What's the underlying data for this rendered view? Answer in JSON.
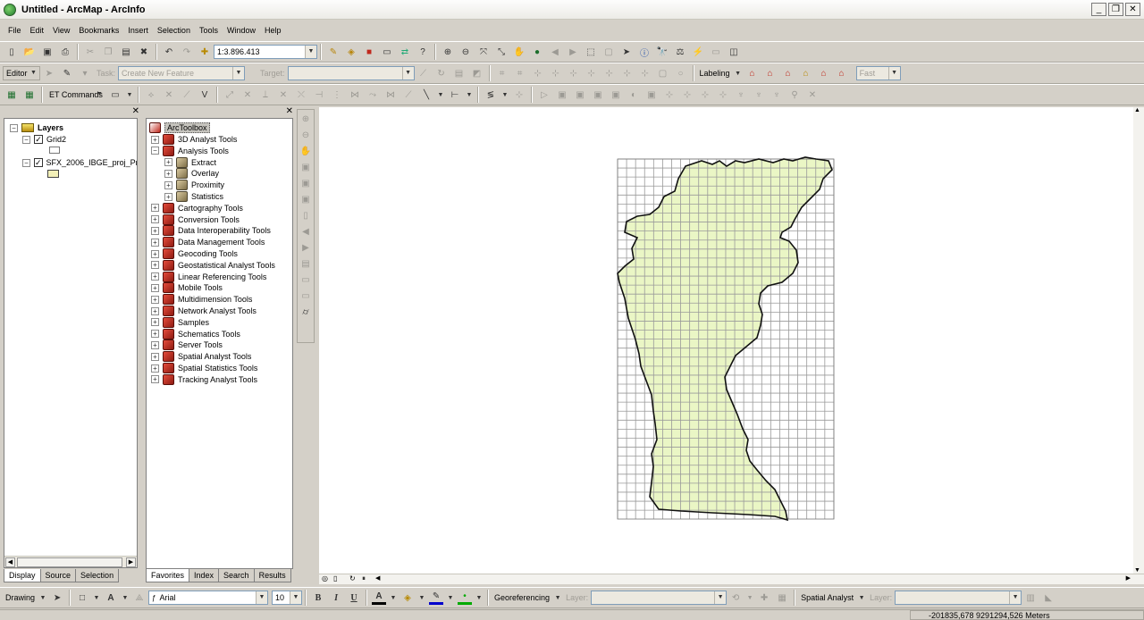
{
  "window": {
    "title": "Untitled - ArcMap - ArcInfo",
    "btns": [
      "_",
      "❐",
      "✕"
    ]
  },
  "menu": [
    "File",
    "Edit",
    "View",
    "Bookmarks",
    "Insert",
    "Selection",
    "Tools",
    "Window",
    "Help"
  ],
  "toolbar_standard": {
    "scale": "1:3.896.413"
  },
  "toolbar_editor": {
    "editor": "Editor",
    "task_label": "Task:",
    "task_value": "Create New Feature",
    "target_label": "Target:",
    "labeling": "Labeling",
    "fast": "Fast"
  },
  "toolbar_et": {
    "et": "ET Commands"
  },
  "toc": {
    "root": "Layers",
    "layers": [
      {
        "name": "Grid2",
        "checked": true
      },
      {
        "name": "SFX_2006_IBGE_proj_Pr",
        "checked": true
      }
    ],
    "tabs": [
      "Display",
      "Source",
      "Selection"
    ]
  },
  "toolbox": {
    "root": "ArcToolbox",
    "items": [
      {
        "label": "3D Analyst Tools",
        "expanded": false,
        "level": 0
      },
      {
        "label": "Analysis Tools",
        "expanded": true,
        "level": 0
      },
      {
        "label": "Extract",
        "level": 1
      },
      {
        "label": "Overlay",
        "level": 1
      },
      {
        "label": "Proximity",
        "level": 1
      },
      {
        "label": "Statistics",
        "level": 1
      },
      {
        "label": "Cartography Tools",
        "level": 0
      },
      {
        "label": "Conversion Tools",
        "level": 0
      },
      {
        "label": "Data Interoperability Tools",
        "level": 0
      },
      {
        "label": "Data Management Tools",
        "level": 0
      },
      {
        "label": "Geocoding Tools",
        "level": 0
      },
      {
        "label": "Geostatistical Analyst Tools",
        "level": 0
      },
      {
        "label": "Linear Referencing Tools",
        "level": 0
      },
      {
        "label": "Mobile Tools",
        "level": 0
      },
      {
        "label": "Multidimension Tools",
        "level": 0
      },
      {
        "label": "Network Analyst Tools",
        "level": 0
      },
      {
        "label": "Samples",
        "level": 0
      },
      {
        "label": "Schematics Tools",
        "level": 0
      },
      {
        "label": "Server Tools",
        "level": 0
      },
      {
        "label": "Spatial Analyst Tools",
        "level": 0
      },
      {
        "label": "Spatial Statistics Tools",
        "level": 0
      },
      {
        "label": "Tracking Analyst Tools",
        "level": 0
      }
    ],
    "tabs": [
      "Favorites",
      "Index",
      "Search",
      "Results"
    ]
  },
  "drawing": {
    "drawing": "Drawing",
    "font": "Arial",
    "size": "10",
    "bold": "B",
    "italic": "I",
    "underline": "U",
    "georef": "Georeferencing",
    "layer_label": "Layer:",
    "spatial": "Spatial Analyst",
    "layer2_label": "Layer:"
  },
  "status": {
    "coords": "-201835,678  9291294,526 Meters"
  },
  "colors": {
    "polygon_fill": "#eaf6c5",
    "grid_line": "#9a9a9a",
    "toolbox_red": "#c0281c"
  },
  "icons": [
    "new-icon",
    "open-icon",
    "save-icon",
    "print-icon",
    "cut-icon",
    "copy-icon",
    "paste-icon",
    "delete-icon",
    "undo-icon",
    "redo-icon",
    "add-data-icon",
    "zoom-in-icon",
    "zoom-out-icon",
    "pan-icon",
    "globe-icon",
    "identify-icon",
    "find-icon",
    "select-arrow-icon"
  ]
}
